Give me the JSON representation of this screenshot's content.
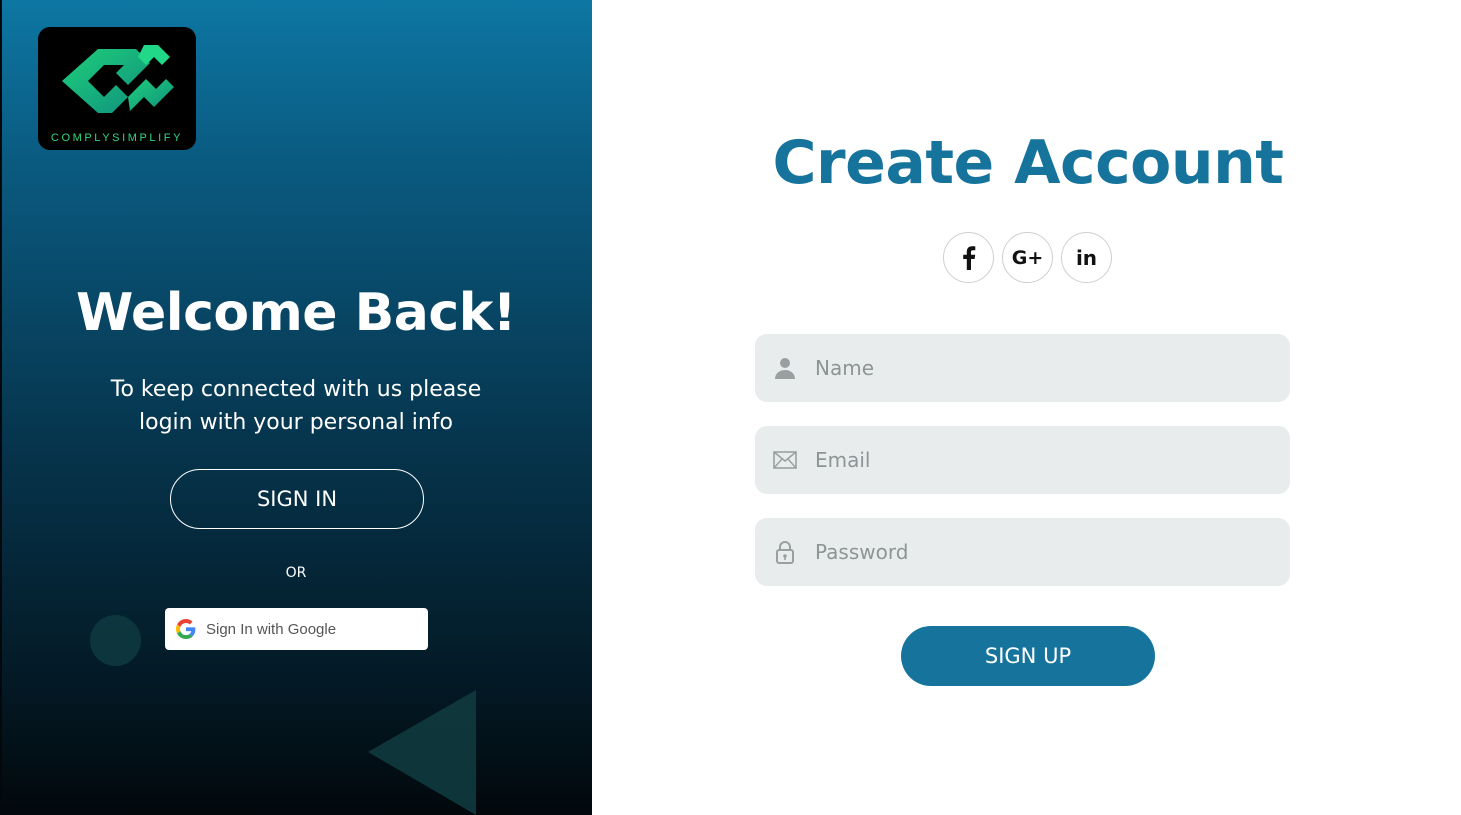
{
  "brand": {
    "logo_text": "COMPLYSIMPLIFY",
    "accent_green": "#2fd882",
    "primary_blue": "#15739c"
  },
  "left": {
    "title": "Welcome Back!",
    "subtitle": "To keep connected with us please login with your personal info",
    "signin_label": "SIGN IN",
    "or_label": "OR",
    "google_label": "Sign In with Google",
    "google_icon": "google-g-icon"
  },
  "right": {
    "title": "Create Account",
    "social": [
      {
        "name": "facebook-icon",
        "glyph": "f"
      },
      {
        "name": "google-plus-icon",
        "glyph": "G+"
      },
      {
        "name": "linkedin-icon",
        "glyph": "in"
      }
    ],
    "fields": {
      "name": {
        "placeholder": "Name",
        "value": "",
        "icon": "user-icon"
      },
      "email": {
        "placeholder": "Email",
        "value": "",
        "icon": "envelope-icon"
      },
      "password": {
        "placeholder": "Password",
        "value": "",
        "icon": "lock-icon"
      }
    },
    "signup_label": "SIGN UP"
  }
}
